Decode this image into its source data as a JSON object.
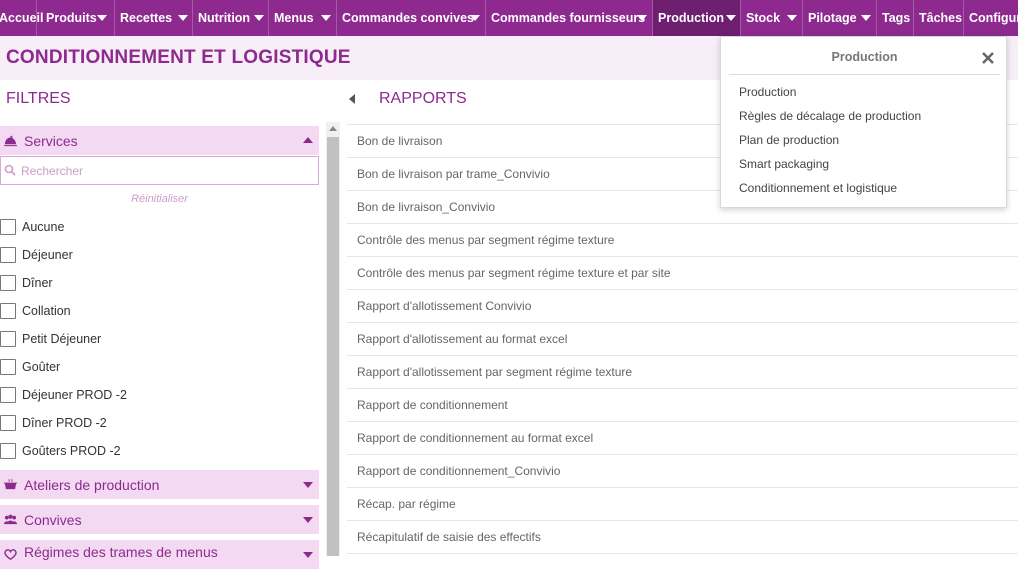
{
  "nav": {
    "items": [
      {
        "label": "Accueil",
        "has_caret": false
      },
      {
        "label": "Produits",
        "has_caret": true
      },
      {
        "label": "Recettes",
        "has_caret": true
      },
      {
        "label": "Nutrition",
        "has_caret": true
      },
      {
        "label": "Menus",
        "has_caret": true
      },
      {
        "label": "Commandes convives",
        "has_caret": true
      },
      {
        "label": "Commandes fournisseurs",
        "has_caret": true
      },
      {
        "label": "Production",
        "has_caret": true,
        "active": true
      },
      {
        "label": "Stock",
        "has_caret": true
      },
      {
        "label": "Pilotage",
        "has_caret": true
      },
      {
        "label": "Tags",
        "has_caret": false
      },
      {
        "label": "Tâches",
        "has_caret": false
      },
      {
        "label": "Configura",
        "has_caret": false
      }
    ]
  },
  "page": {
    "title": "CONDITIONNEMENT ET LOGISTIQUE",
    "filters_title": "FILTRES",
    "reports_title": "RAPPORTS"
  },
  "filters": {
    "services": {
      "label": "Services",
      "icon": "cloche-icon",
      "search_placeholder": "Rechercher",
      "search_value": "",
      "reset_label": "Réinitialiser",
      "options": [
        {
          "label": "Aucune",
          "checked": false
        },
        {
          "label": "Déjeuner",
          "checked": false
        },
        {
          "label": "Dîner",
          "checked": false
        },
        {
          "label": "Collation",
          "checked": false
        },
        {
          "label": "Petit Déjeuner",
          "checked": false
        },
        {
          "label": "Goûter",
          "checked": false
        },
        {
          "label": "Déjeuner PROD -2",
          "checked": false
        },
        {
          "label": "Dîner PROD -2",
          "checked": false
        },
        {
          "label": "Goûters PROD -2",
          "checked": false
        }
      ]
    },
    "ateliers": {
      "label": "Ateliers de production",
      "icon": "pot-icon"
    },
    "convives": {
      "label": "Convives",
      "icon": "people-icon"
    },
    "regimes": {
      "label": "Régimes des trames de menus",
      "icon": "heart-icon"
    }
  },
  "reports": [
    "Bon de livraison",
    "Bon de livraison par trame_Convivio",
    "Bon de livraison_Convivio",
    "Contrôle des menus par segment régime texture",
    "Contrôle des menus par segment régime texture et par site",
    "Rapport d'allotissement Convivio",
    "Rapport d'allotissement au format excel",
    "Rapport d'allotissement par segment régime texture",
    "Rapport de conditionnement",
    "Rapport de conditionnement au format excel",
    "Rapport de conditionnement_Convivio",
    "Récap. par régime",
    "Récapitulatif de saisie des effectifs"
  ],
  "dropdown": {
    "title": "Production",
    "items": [
      "Production",
      "Règles de décalage de production",
      "Plan de production",
      "Smart packaging",
      "Conditionnement et logistique"
    ]
  },
  "colors": {
    "brand": "#8e2a8f",
    "nav_active": "#6e1f70",
    "section_bg": "#f3d9f2",
    "title_band": "#f7eef7"
  }
}
